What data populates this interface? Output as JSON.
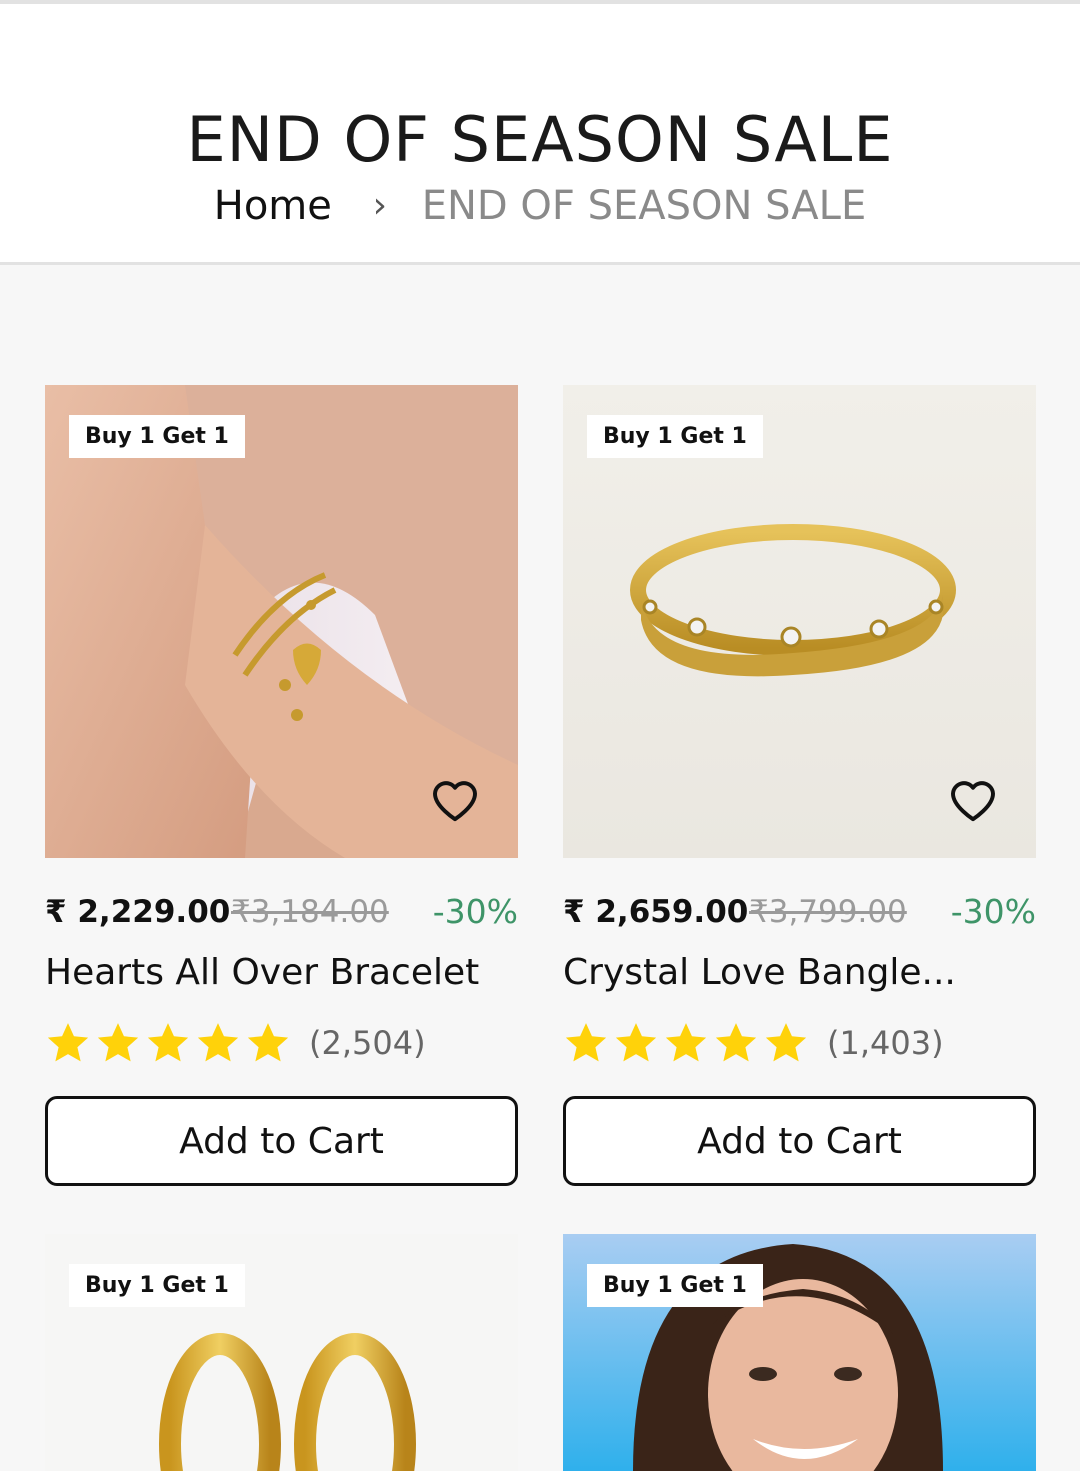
{
  "header": {
    "title": "END OF SEASON SALE",
    "breadcrumb": {
      "home": "Home",
      "separator": "›",
      "current": "END OF SEASON SALE"
    }
  },
  "products": [
    {
      "badge": "Buy 1 Get 1",
      "price": "₹ 2,229.00",
      "mrp": "₹3,184.00",
      "discount": "-30%",
      "name": "Hearts All Over Bracelet",
      "rating": 5,
      "reviews": "(2,504)",
      "cta": "Add to Cart",
      "image": "bracelet-on-wrist"
    },
    {
      "badge": "Buy 1 Get 1",
      "price": "₹ 2,659.00",
      "mrp": "₹3,799.00",
      "discount": "-30%",
      "name": "Crystal Love Bangle...",
      "rating": 5,
      "reviews": "(1,403)",
      "cta": "Add to Cart",
      "image": "gold-bangle"
    },
    {
      "badge": "Buy 1 Get 1",
      "image": "gold-hoop-earrings"
    },
    {
      "badge": "Buy 1 Get 1",
      "image": "model-portrait"
    }
  ],
  "colors": {
    "discount": "#3e9468",
    "star": "#ffd20a",
    "badge_bg": "#ffffff"
  },
  "icons": [
    "chevron-right-icon",
    "heart-icon",
    "star-icon"
  ]
}
